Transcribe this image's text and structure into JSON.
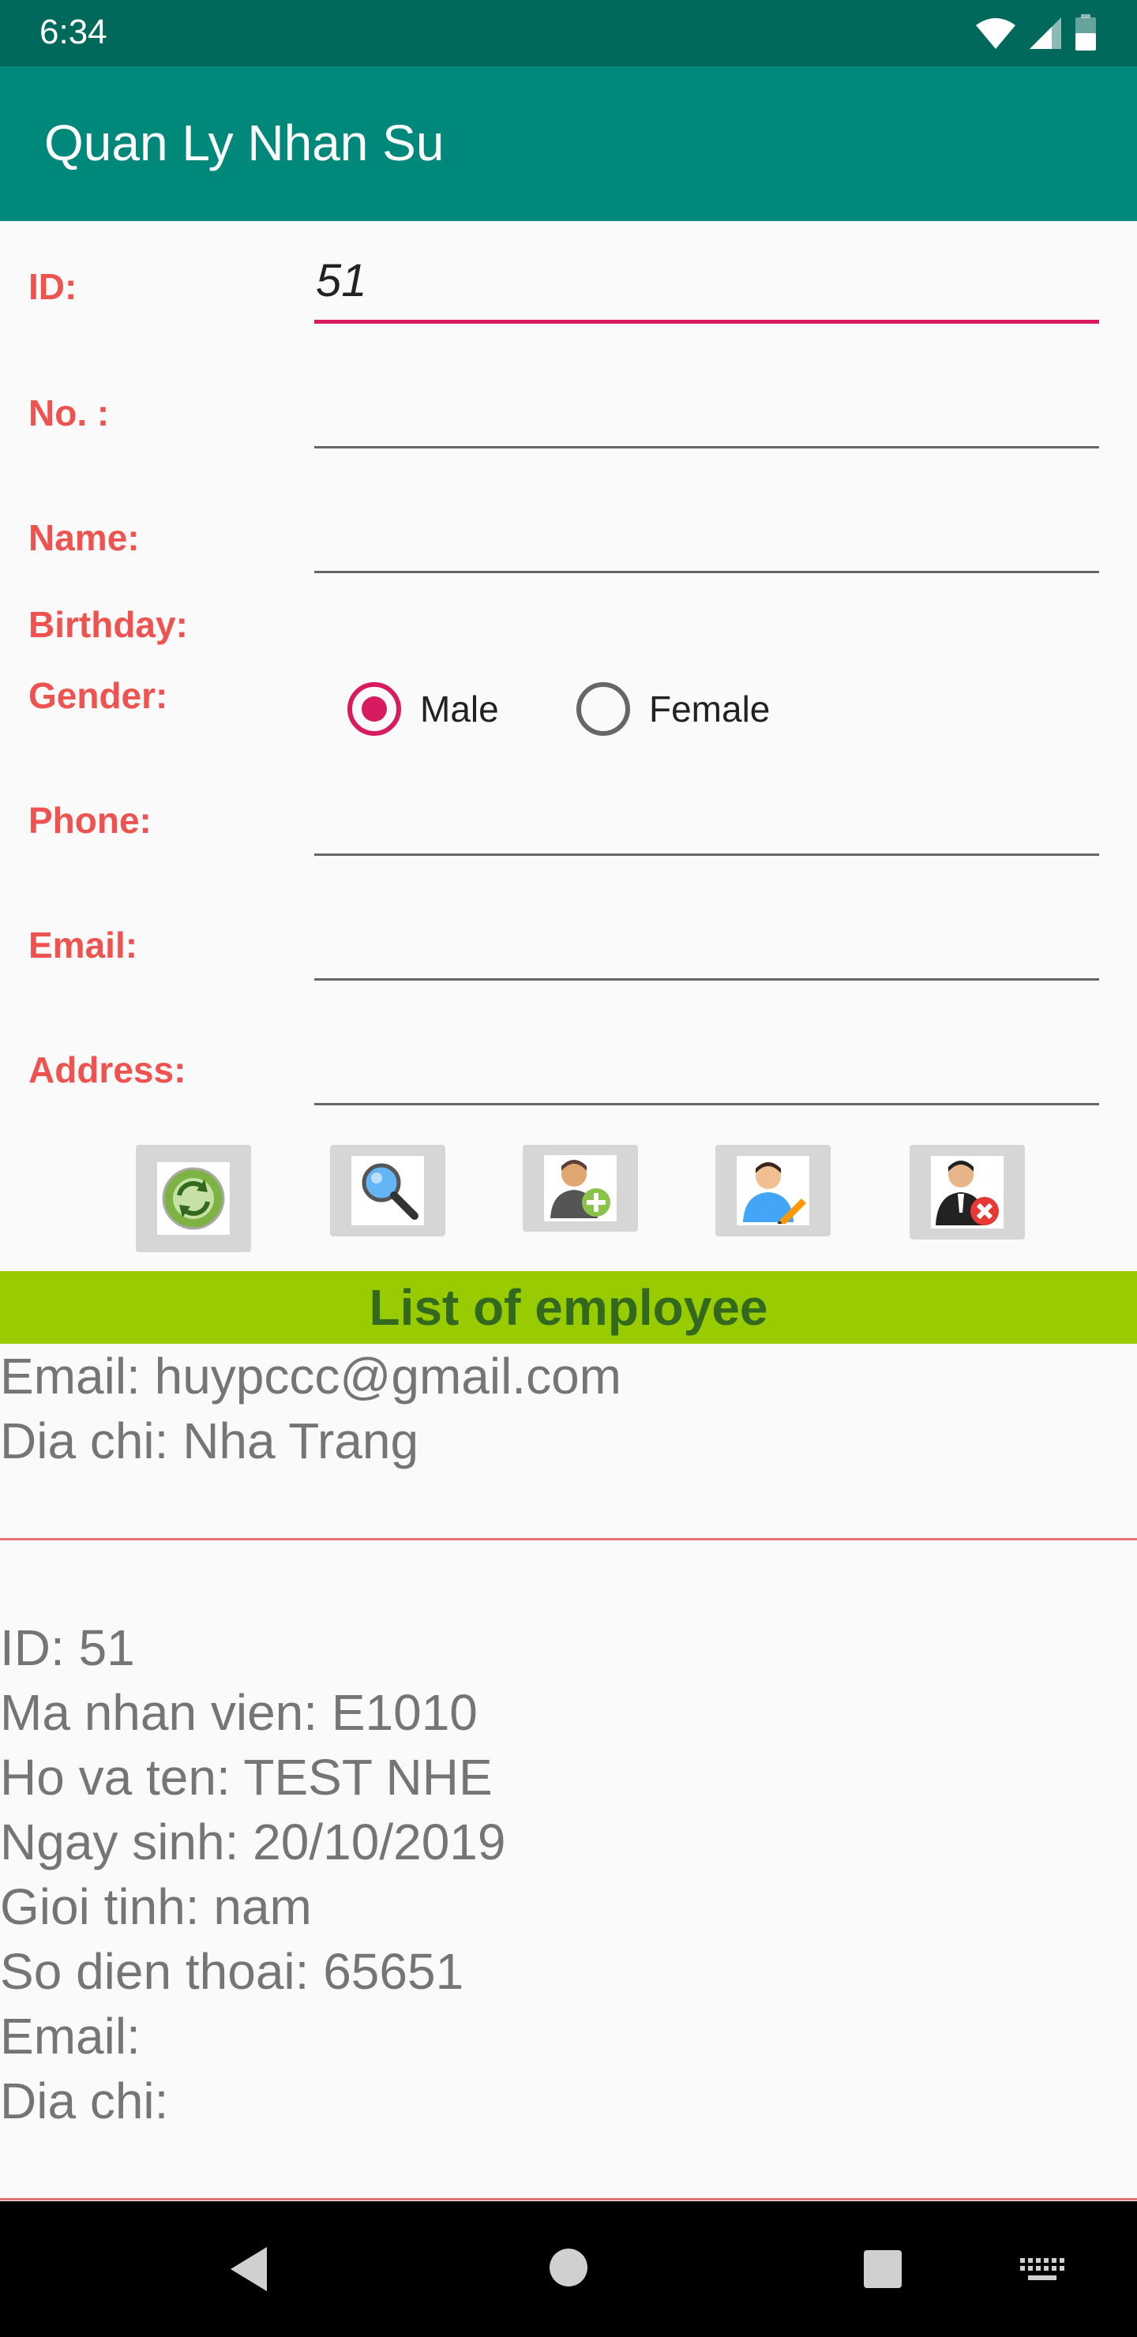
{
  "status_bar": {
    "time": "6:34"
  },
  "app_bar": {
    "title": "Quan Ly Nhan Su"
  },
  "form": {
    "id_label": "ID:",
    "id_value": "51",
    "no_label": "No. :",
    "name_label": "Name:",
    "birthday_label": "Birthday:",
    "gender_label": "Gender:",
    "gender_male": "Male",
    "gender_female": "Female",
    "gender_selected": "Male",
    "phone_label": "Phone:",
    "email_label": "Email:",
    "address_label": "Address:"
  },
  "actions": {
    "refresh_icon": "refresh-icon",
    "search_icon": "search-icon",
    "add_icon": "add-user-icon",
    "edit_icon": "edit-user-icon",
    "delete_icon": "delete-user-icon"
  },
  "list": {
    "header": "List of employee",
    "previous_partial": {
      "email": "Email: huypccc@gmail.com",
      "address": "Dia chi: Nha Trang"
    },
    "record": {
      "id": "ID: 51",
      "code": "Ma nhan vien: E1010",
      "name": "Ho va ten: TEST NHE",
      "birthday": "Ngay sinh: 20/10/2019",
      "gender": "Gioi tinh: nam",
      "phone": "So dien thoai: 65651",
      "email": "Email:",
      "address": "Dia chi:"
    }
  },
  "colors": {
    "status_bar": "#00695c",
    "app_bar": "#00897b",
    "label": "#ef5350",
    "accent": "#d81b60",
    "list_header": "#99cc00",
    "list_header_text": "#33691e"
  }
}
